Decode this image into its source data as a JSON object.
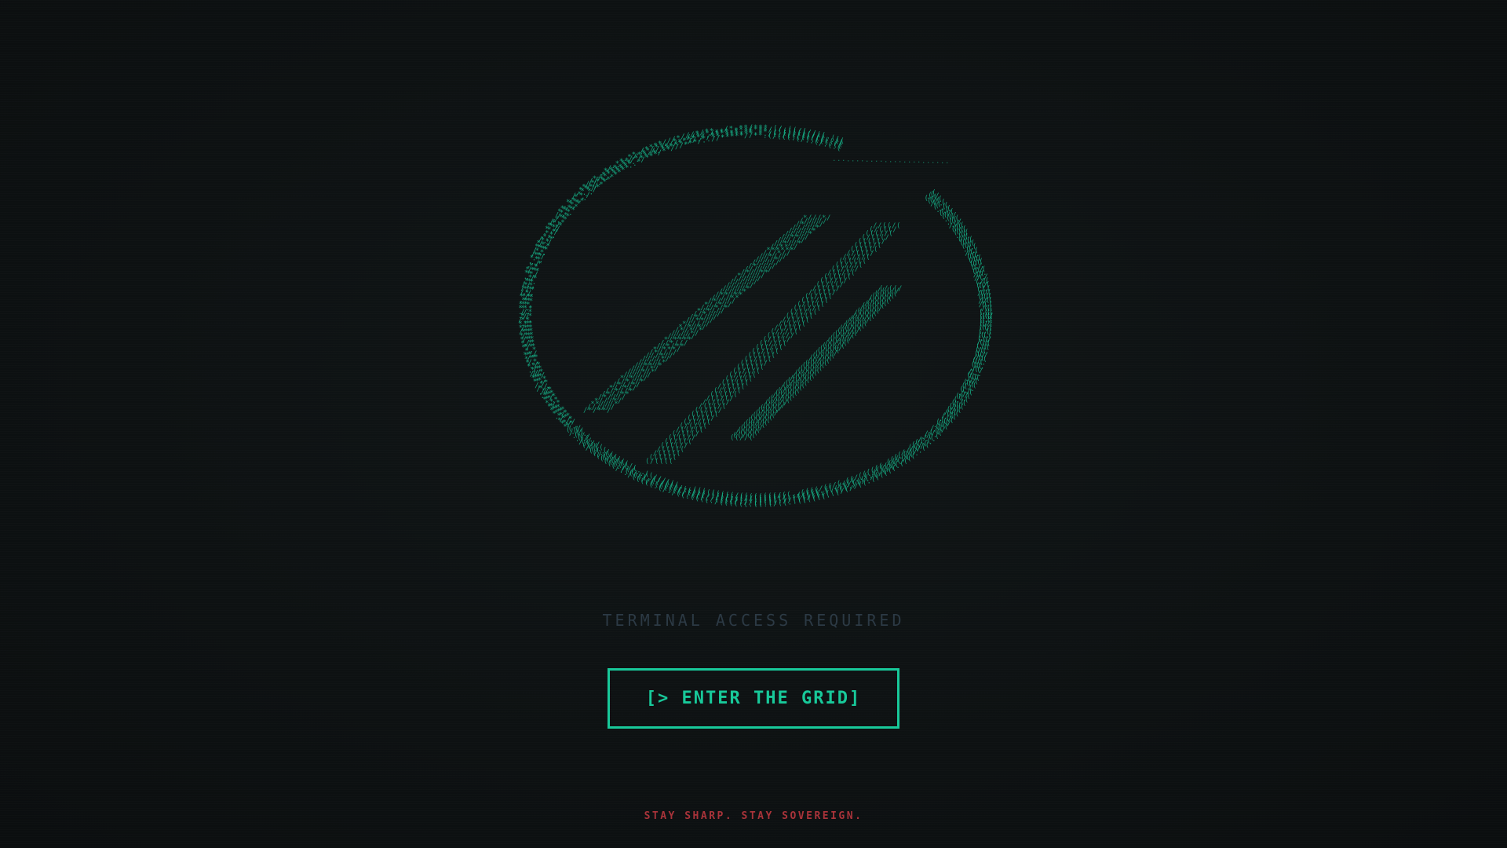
{
  "screen": {
    "status_text": "TERMINAL ACCESS REQUIRED",
    "enter_button_label": "[> ENTER THE GRID]",
    "tagline": "STAY SHARP. STAY SOVEREIGN."
  },
  "logo": {
    "icon": "ascii-circle-slash-logo-icon",
    "glyph_color": "#17b88d"
  },
  "colors": {
    "background": "#0d1112",
    "accent": "#18c99a",
    "muted_text": "#2c3a45",
    "tagline": "#a8333a"
  }
}
